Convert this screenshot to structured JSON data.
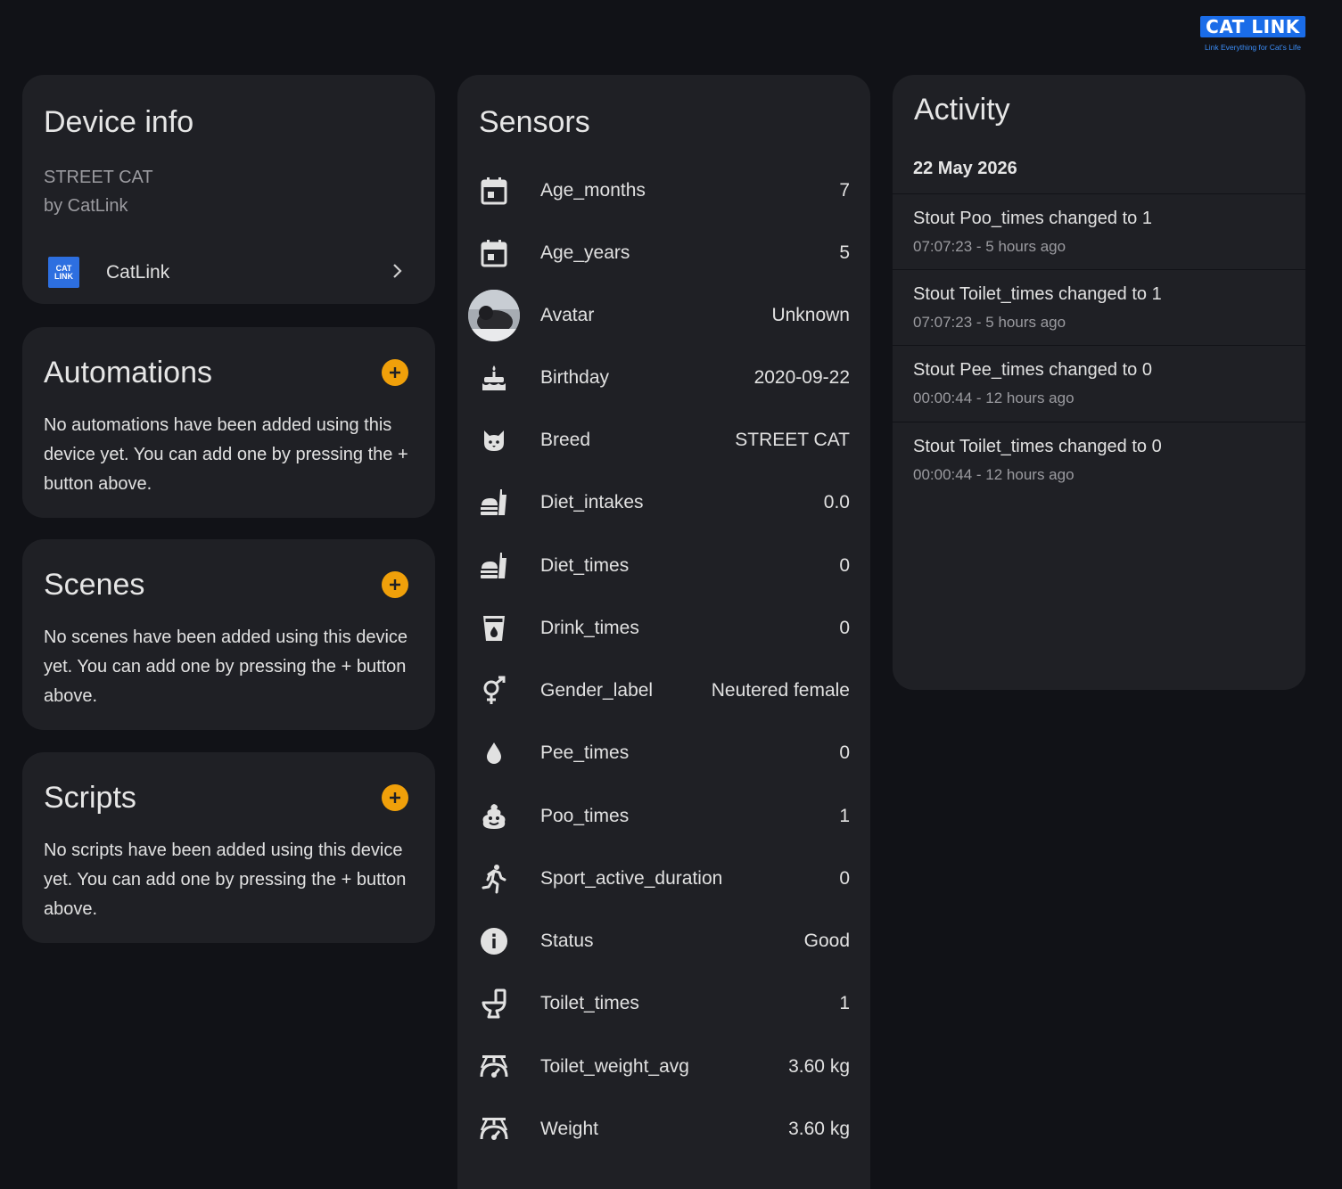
{
  "logo": {
    "text": "CAT LINK",
    "tagline": "Link Everything for Cat's Life"
  },
  "device_info": {
    "title": "Device info",
    "model": "STREET CAT",
    "manufacturer": "by CatLink",
    "integration": {
      "label": "CatLink",
      "icon_text_1": "CAT",
      "icon_text_2": "LINK"
    }
  },
  "automations": {
    "title": "Automations",
    "text": "No automations have been added using this device yet. You can add one by pressing the + button above."
  },
  "scenes": {
    "title": "Scenes",
    "text": "No scenes have been added using this device yet. You can add one by pressing the + button above."
  },
  "scripts": {
    "title": "Scripts",
    "text": "No scripts have been added using this device yet. You can add one by pressing the + button above."
  },
  "sensors": {
    "title": "Sensors",
    "items": [
      {
        "name": "Age_months",
        "value": "7",
        "icon": "calendar-icon"
      },
      {
        "name": "Age_years",
        "value": "5",
        "icon": "calendar-icon"
      },
      {
        "name": "Avatar",
        "value": "Unknown",
        "icon": "avatar-image"
      },
      {
        "name": "Birthday",
        "value": "2020-09-22",
        "icon": "cake-icon"
      },
      {
        "name": "Breed",
        "value": "STREET CAT",
        "icon": "cat-icon"
      },
      {
        "name": "Diet_intakes",
        "value": "0.0",
        "icon": "food-icon"
      },
      {
        "name": "Diet_times",
        "value": "0",
        "icon": "food-icon"
      },
      {
        "name": "Drink_times",
        "value": "0",
        "icon": "cup-water-icon"
      },
      {
        "name": "Gender_label",
        "value": "Neutered female",
        "icon": "gender-icon"
      },
      {
        "name": "Pee_times",
        "value": "0",
        "icon": "water-drop-icon"
      },
      {
        "name": "Poo_times",
        "value": "1",
        "icon": "emoticon-poop-icon"
      },
      {
        "name": "Sport_active_duration",
        "value": "0",
        "icon": "run-icon"
      },
      {
        "name": "Status",
        "value": "Good",
        "icon": "information-icon"
      },
      {
        "name": "Toilet_times",
        "value": "1",
        "icon": "toilet-icon"
      },
      {
        "name": "Toilet_weight_avg",
        "value": "3.60 kg",
        "icon": "scale-icon"
      },
      {
        "name": "Weight",
        "value": "3.60 kg",
        "icon": "scale-icon"
      }
    ]
  },
  "activity": {
    "title": "Activity",
    "date": "22 May 2026",
    "items": [
      {
        "message": "Stout Poo_times changed to 1",
        "time": "07:07:23 - 5 hours ago"
      },
      {
        "message": "Stout Toilet_times changed to 1",
        "time": "07:07:23 - 5 hours ago"
      },
      {
        "message": "Stout Pee_times changed to 0",
        "time": "00:00:44 - 12 hours ago"
      },
      {
        "message": "Stout Toilet_times changed to 0",
        "time": "00:00:44 - 12 hours ago"
      }
    ]
  },
  "colors": {
    "background": "#111217",
    "card": "#1f2025",
    "accent": "#f0a00a",
    "brand": "#1a6ce8"
  }
}
